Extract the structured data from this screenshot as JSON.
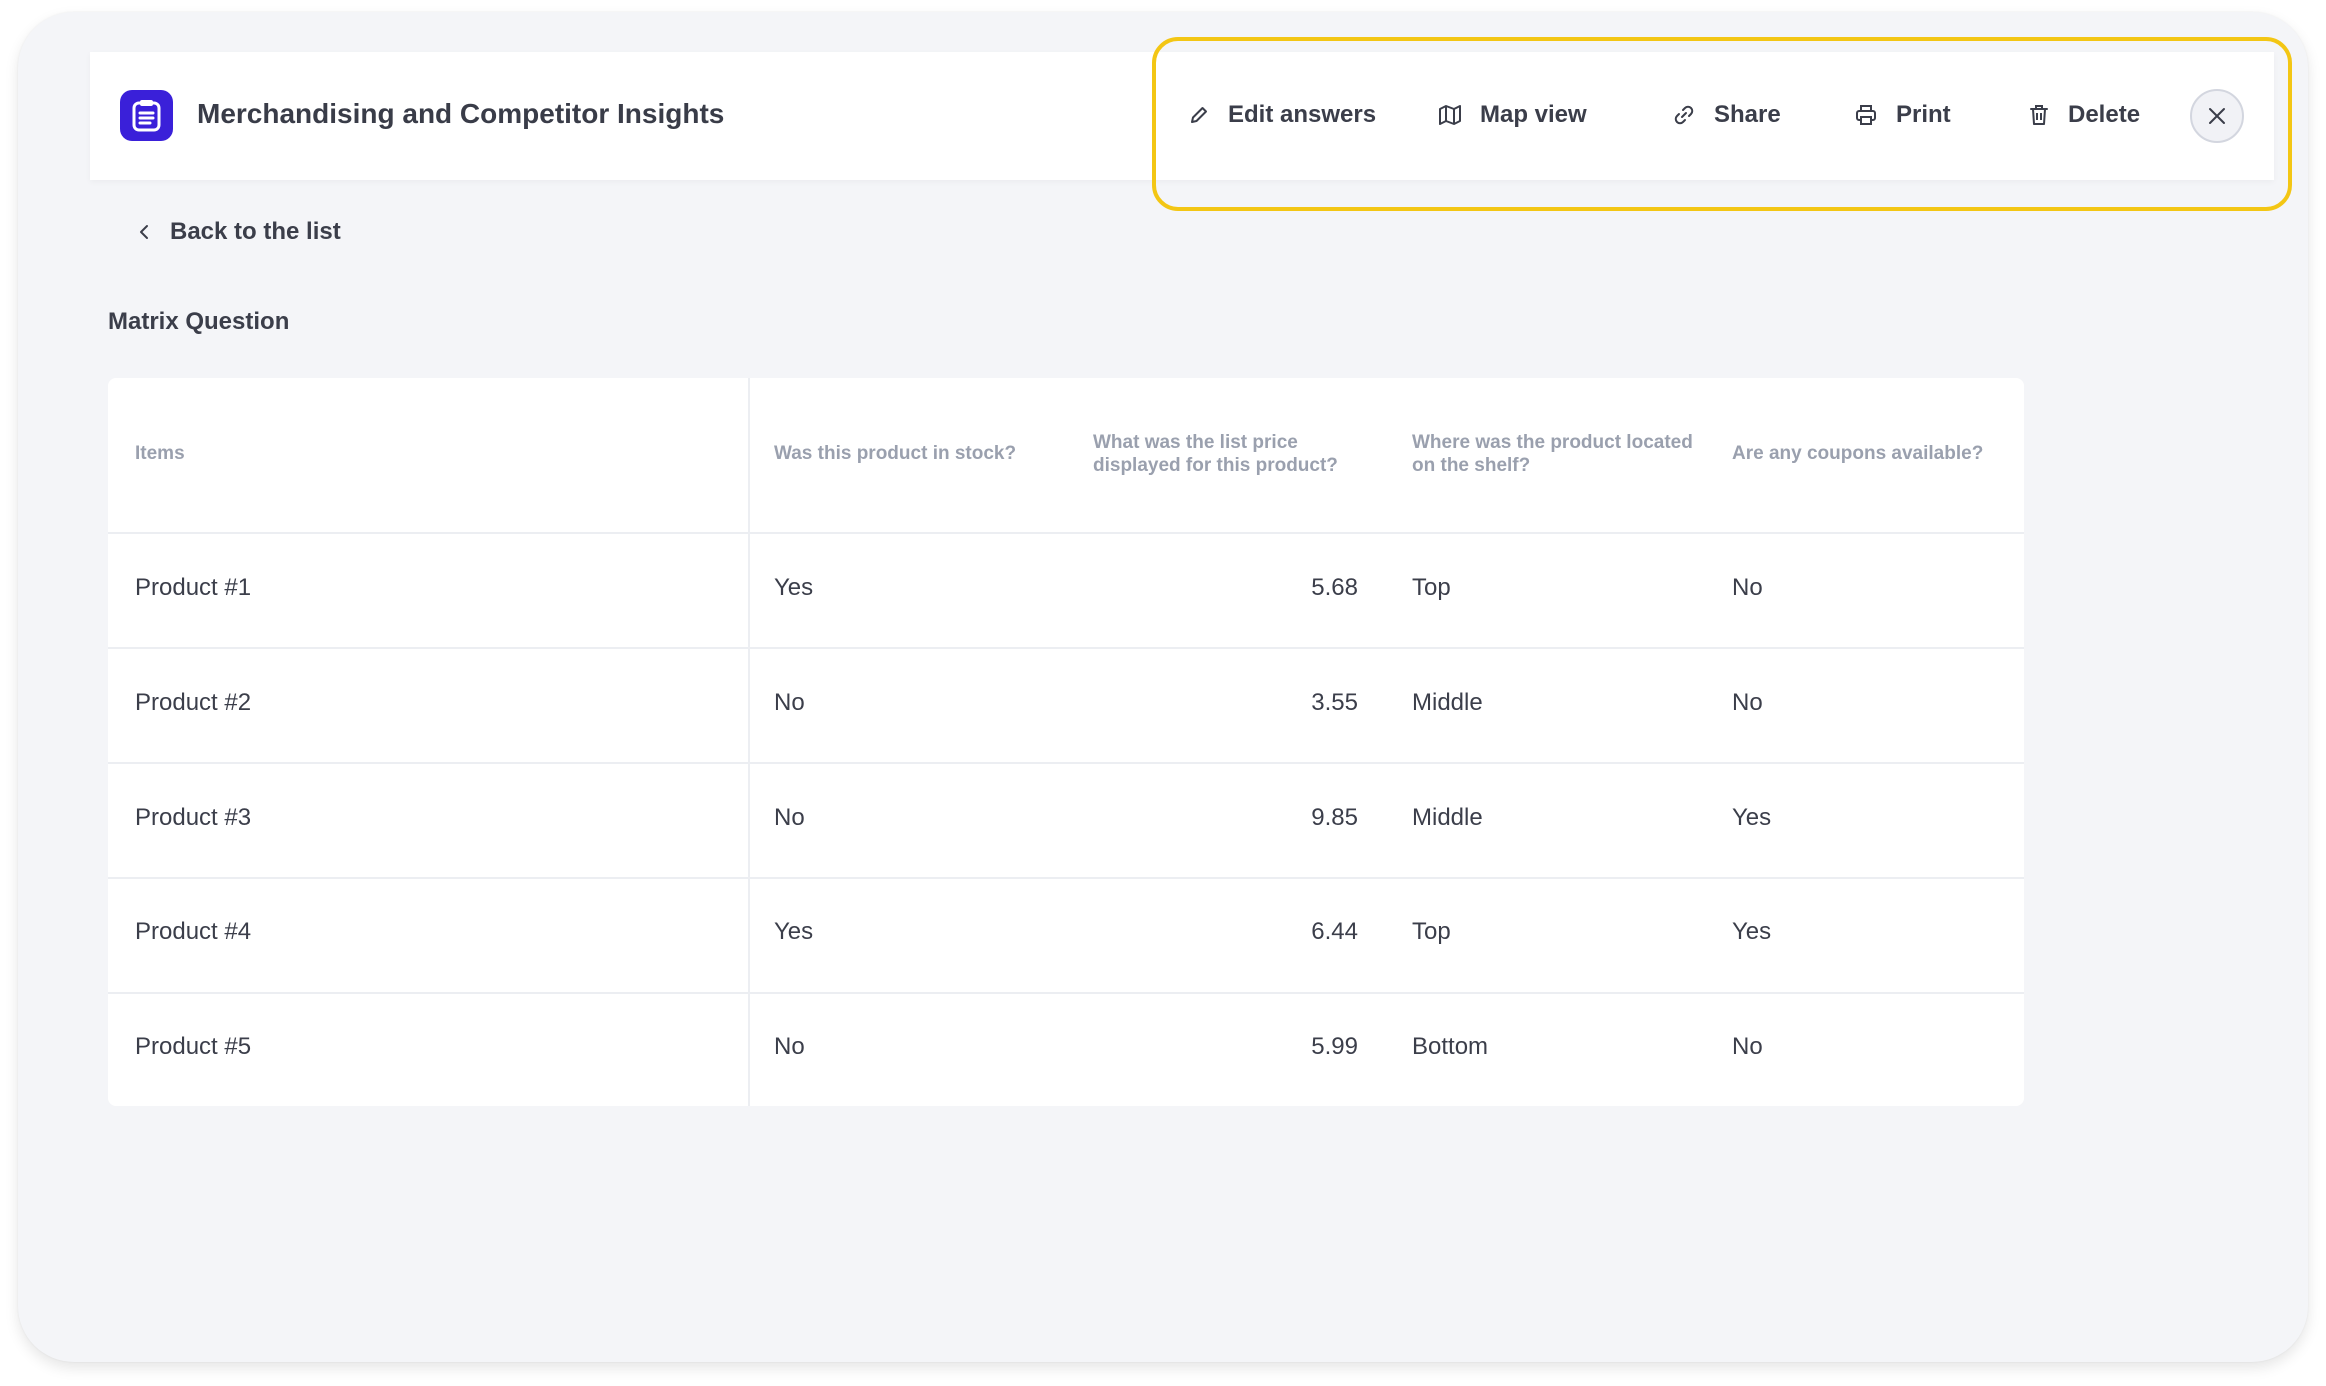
{
  "header": {
    "title": "Merchandising and Competitor Insights",
    "accent_color": "#3a20d9",
    "app_icon": "clipboard-icon",
    "highlight_color": "#f3c614",
    "actions": {
      "edit": {
        "label": "Edit answers",
        "icon": "pencil-icon"
      },
      "map": {
        "label": "Map view",
        "icon": "map-icon"
      },
      "share": {
        "label": "Share",
        "icon": "link-icon"
      },
      "print": {
        "label": "Print",
        "icon": "printer-icon"
      },
      "delete": {
        "label": "Delete",
        "icon": "trash-icon"
      },
      "close": {
        "icon": "close-icon"
      }
    }
  },
  "nav": {
    "back_label": "Back to the list",
    "back_icon": "chevron-left-icon"
  },
  "section": {
    "title": "Matrix Question"
  },
  "table": {
    "headers": {
      "items": "Items",
      "stock": "Was this product in stock?",
      "price_line1": "What was the list price",
      "price_line2": "displayed for this product?",
      "location_line1": "Where was the product located",
      "location_line2": "on the shelf?",
      "coupons": "Are any coupons available?"
    },
    "rows": [
      {
        "item": "Product #1",
        "stock": "Yes",
        "price": "5.68",
        "location": "Top",
        "coupons": "No"
      },
      {
        "item": "Product #2",
        "stock": "No",
        "price": "3.55",
        "location": "Middle",
        "coupons": "No"
      },
      {
        "item": "Product #3",
        "stock": "No",
        "price": "9.85",
        "location": "Middle",
        "coupons": "Yes"
      },
      {
        "item": "Product #4",
        "stock": "Yes",
        "price": "6.44",
        "location": "Top",
        "coupons": "Yes"
      },
      {
        "item": "Product #5",
        "stock": "No",
        "price": "5.99",
        "location": "Bottom",
        "coupons": "No"
      }
    ]
  }
}
